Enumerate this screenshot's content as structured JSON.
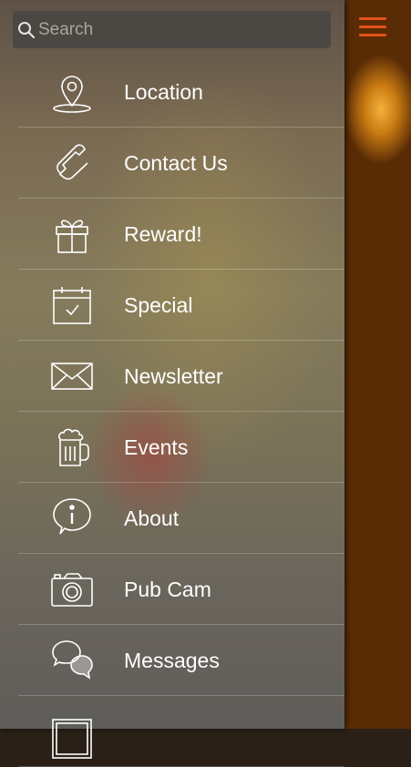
{
  "search": {
    "placeholder": "Search"
  },
  "menu": {
    "items": [
      {
        "label": "Location",
        "icon": "location-pin-icon"
      },
      {
        "label": "Contact Us",
        "icon": "phone-icon"
      },
      {
        "label": "Reward!",
        "icon": "gift-icon"
      },
      {
        "label": "Special",
        "icon": "calendar-check-icon"
      },
      {
        "label": "Newsletter",
        "icon": "envelope-icon"
      },
      {
        "label": "Events",
        "icon": "beer-mug-icon"
      },
      {
        "label": "About",
        "icon": "info-bubble-icon"
      },
      {
        "label": "Pub Cam",
        "icon": "camera-icon"
      },
      {
        "label": "Messages",
        "icon": "chat-bubbles-icon"
      },
      {
        "label": "",
        "icon": "frame-icon"
      }
    ]
  },
  "colors": {
    "accent": "#e2541c",
    "drawer_text": "#ffffff",
    "search_bg": "#4b4844"
  }
}
